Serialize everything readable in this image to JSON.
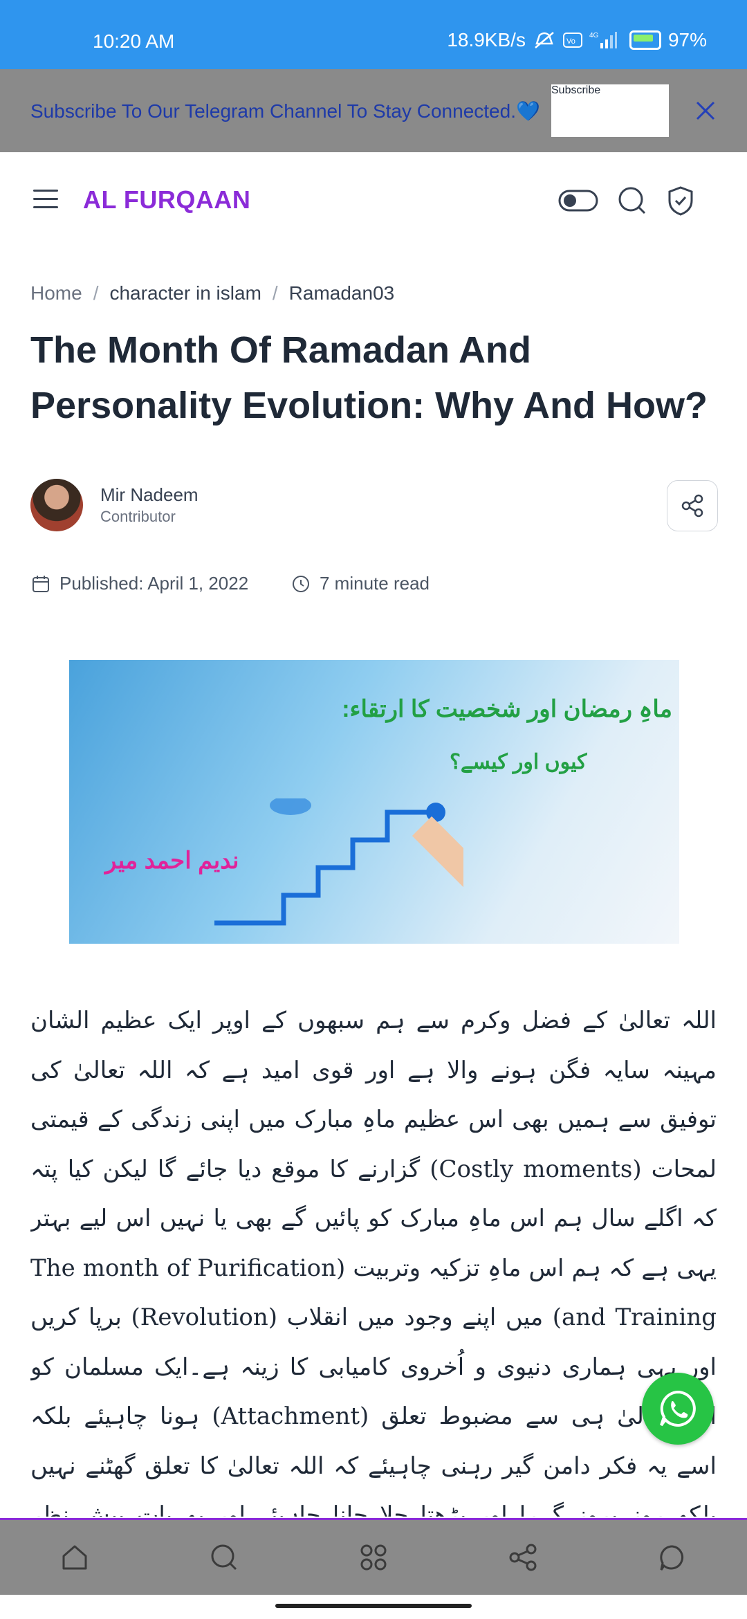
{
  "status": {
    "time": "10:20 AM",
    "network": "18.9KB/s",
    "battery": "97%"
  },
  "promo": {
    "text": "Subscribe To Our Telegram Channel To Stay Connected.💙",
    "subscribe_label": "Subscribe"
  },
  "header": {
    "logo": "AL FURQAAN"
  },
  "breadcrumb": {
    "home": "Home",
    "category": "character in islam",
    "current": "Ramadan03",
    "sep": "/"
  },
  "article": {
    "title": "The Month Of Ramadan And Personality Evolution: Why And How?",
    "author": "Mir Nadeem",
    "role": "Contributor",
    "published": "Published: April 1, 2022",
    "read_time": "7 minute read",
    "hero": {
      "urdu_title_1": "ماہِ رمضان اور شخصیت کا ارتقاء:",
      "urdu_title_2": "کیوں اور کیسے؟",
      "urdu_name": "ندیم احمد میر"
    },
    "body": "اللہ تعالیٰ کے فضل وکرم سے ہم سبھوں کے اوپر ایک عظیم الشان مہینہ سایہ فگن ہونے والا ہے اور قوی امید ہے کہ اللہ تعالیٰ کی توفیق سے ہمیں بھی اس عظیم ماہِ مبارک میں اپنی زندگی کے قیمتی لمحات (Costly moments) گزارنے کا موقع دیا جائے گا لیکن کیا پتہ کہ اگلے سال ہم اس ماہِ مبارک کو پائیں گے بھی یا نہیں اس لیے بہتر یہی ہے کہ ہم اس ماہِ تزکیہ وتربیت (The month of Purification and Training) میں اپنے وجود میں انقلاب (Revolution) برپا کریں اور یہی ہماری دنیوی و اُخروی کامیابی کا زینہ ہے۔ایک مسلمان کو اللہ تعالیٰ ہی سے مضبوط تعلق (Attachment) ہونا چاہیئے بلکہ اسے یہ فکر دامن گیر رہنی چاہیئے کہ اللہ تعالیٰ کا تعلق گھٹنے نہیں بلکہ روز بروز گہرا اور بڑھتا چلا جانا چاہیئے اور یہ بات پیش نظر رہنی چاہیئے کہ اللہ تعالیٰ کی راہ میں مستقل مزاجی (Consistency) سے چلنے کے لیے اللہ تعالیٰ کے ساتھ مضبوط تعلق کی ضرورت ہے"
  },
  "colors": {
    "status_bar": "#2f95ee",
    "brand": "#8b2bd8",
    "whatsapp": "#27c445"
  }
}
